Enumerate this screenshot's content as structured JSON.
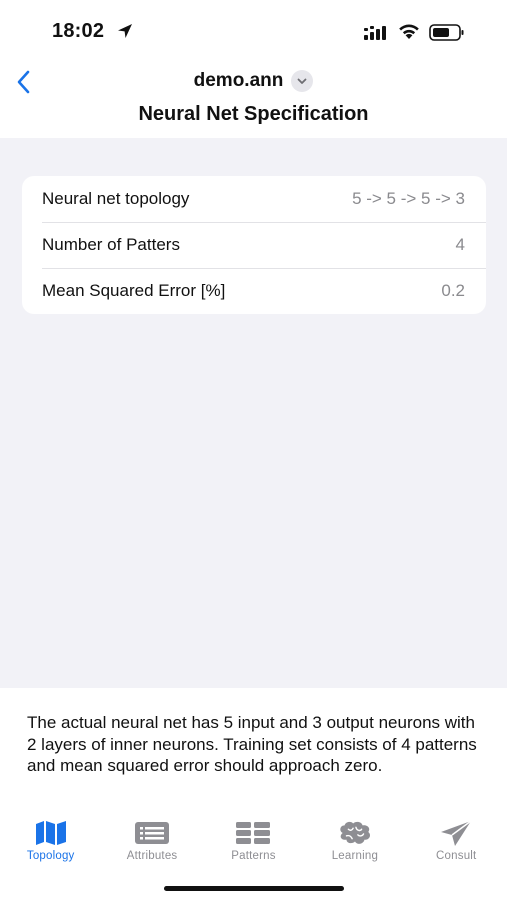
{
  "status_bar": {
    "time": "18:02"
  },
  "nav": {
    "document_name": "demo.ann",
    "page_title": "Neural Net Specification"
  },
  "spec_rows": [
    {
      "label": "Neural net topology",
      "value": "5 -> 5 -> 5 -> 3"
    },
    {
      "label": "Number of Patters",
      "value": "4"
    },
    {
      "label": "Mean Squared Error [%]",
      "value": "0.2"
    }
  ],
  "description": "The actual neural net has 5 input and 3 output neurons with 2 layers of inner neurons. Training set consists of 4 patterns and mean squared error should approach zero.",
  "tabs": [
    {
      "label": "Topology",
      "icon": "map-icon",
      "active": true
    },
    {
      "label": "Attributes",
      "icon": "list-icon",
      "active": false
    },
    {
      "label": "Patterns",
      "icon": "table-icon",
      "active": false
    },
    {
      "label": "Learning",
      "icon": "brain-icon",
      "active": false
    },
    {
      "label": "Consult",
      "icon": "paper-plane-icon",
      "active": false
    }
  ],
  "colors": {
    "accent": "#1a73e8",
    "inactive_tab": "#8e8e93",
    "grouped_background": "#f2f2f7"
  }
}
